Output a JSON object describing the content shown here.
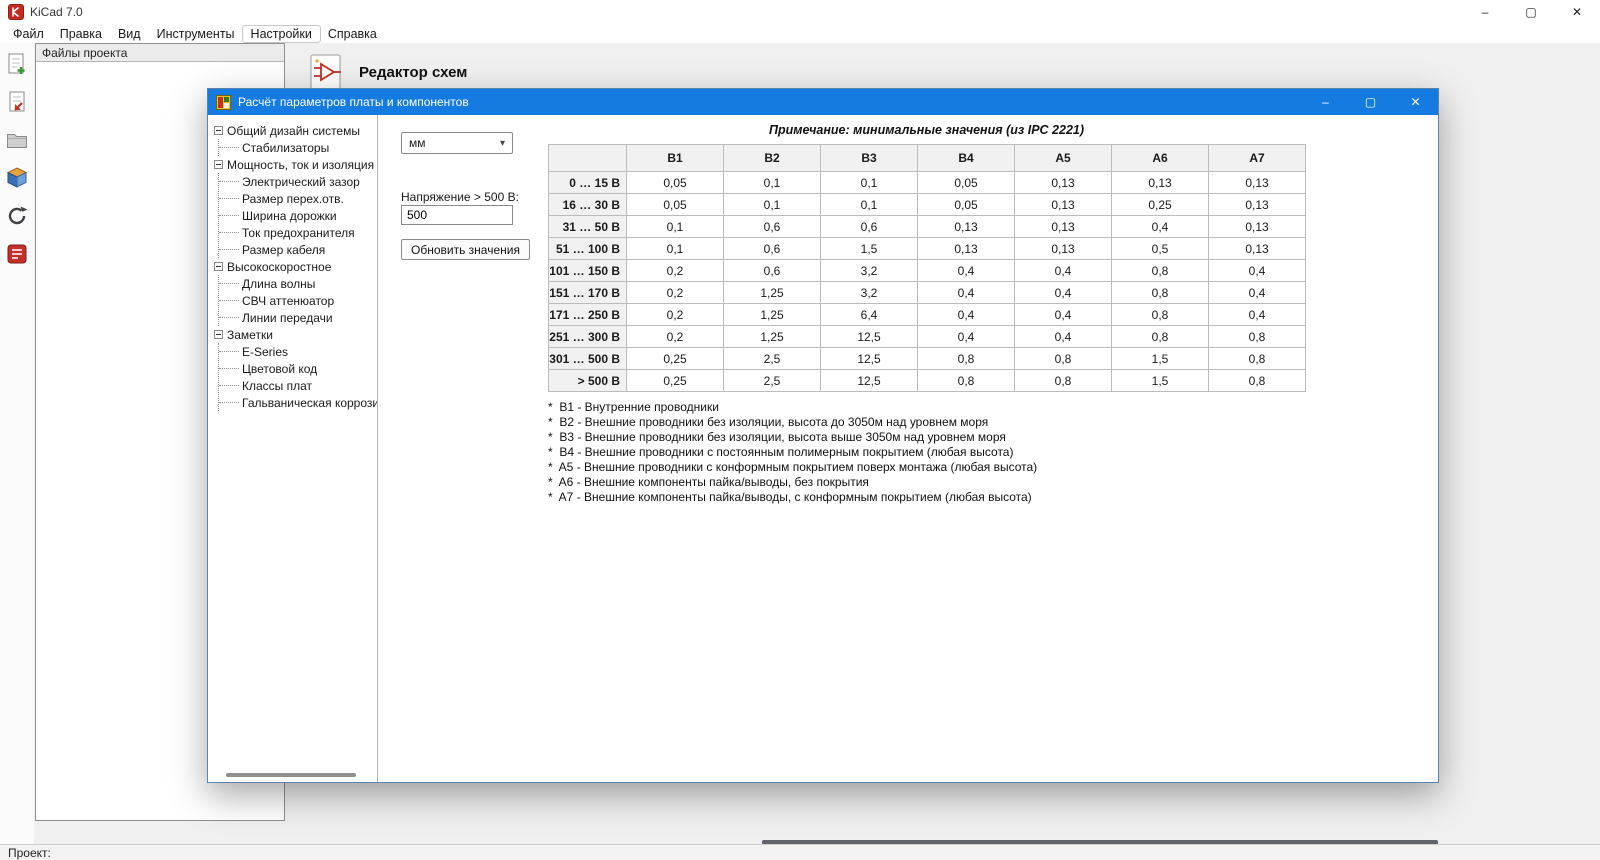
{
  "colors": {
    "dialog_titlebar": "#157be0"
  },
  "icons": {
    "minimize": "–",
    "maximize": "▢",
    "close": "✕",
    "chevron": "▾"
  },
  "app": {
    "title": "KiCad 7.0",
    "menus": [
      "Файл",
      "Правка",
      "Вид",
      "Инструменты",
      "Настройки",
      "Справка"
    ],
    "project_panel": {
      "title": "Файлы проекта"
    },
    "home": {
      "schematic_editor_label": "Редактор схем"
    },
    "statusbar": {
      "project_label": "Проект:"
    }
  },
  "dialog": {
    "title": "Расчёт параметров платы и компонентов",
    "tree": [
      {
        "label": "Общий дизайн системы",
        "level": 0
      },
      {
        "label": "Стабилизаторы",
        "level": 1
      },
      {
        "label": "Мощность, ток и изоляция",
        "level": 0
      },
      {
        "label": "Электрический зазор",
        "level": 1
      },
      {
        "label": "Размер перех.отв.",
        "level": 1
      },
      {
        "label": "Ширина дорожки",
        "level": 1
      },
      {
        "label": "Ток предохранителя",
        "level": 1
      },
      {
        "label": "Размер кабеля",
        "level": 1
      },
      {
        "label": "Высокоскоростное",
        "level": 0
      },
      {
        "label": "Длина волны",
        "level": 1
      },
      {
        "label": "СВЧ аттенюатор",
        "level": 1
      },
      {
        "label": "Линии передачи",
        "level": 1
      },
      {
        "label": "Заметки",
        "level": 0
      },
      {
        "label": "E-Series",
        "level": 1
      },
      {
        "label": "Цветовой код",
        "level": 1
      },
      {
        "label": "Классы плат",
        "level": 1
      },
      {
        "label": "Гальваническая коррози",
        "level": 1
      }
    ],
    "controls": {
      "units": "мм",
      "voltage_label": "Напряжение > 500 В:",
      "voltage_value": "500",
      "update_button": "Обновить значения"
    },
    "table": {
      "note": "Примечание: минимальные значения (из IPC 2221)",
      "headers": [
        "",
        "B1",
        "B2",
        "B3",
        "B4",
        "A5",
        "A6",
        "A7"
      ],
      "rows": [
        {
          "range": "0 … 15 В",
          "values": [
            "0,05",
            "0,1",
            "0,1",
            "0,05",
            "0,13",
            "0,13",
            "0,13"
          ]
        },
        {
          "range": "16 … 30 В",
          "values": [
            "0,05",
            "0,1",
            "0,1",
            "0,05",
            "0,13",
            "0,25",
            "0,13"
          ]
        },
        {
          "range": "31 … 50 В",
          "values": [
            "0,1",
            "0,6",
            "0,6",
            "0,13",
            "0,13",
            "0,4",
            "0,13"
          ]
        },
        {
          "range": "51 … 100 В",
          "values": [
            "0,1",
            "0,6",
            "1,5",
            "0,13",
            "0,13",
            "0,5",
            "0,13"
          ]
        },
        {
          "range": "101 … 150 В",
          "values": [
            "0,2",
            "0,6",
            "3,2",
            "0,4",
            "0,4",
            "0,8",
            "0,4"
          ]
        },
        {
          "range": "151 … 170 В",
          "values": [
            "0,2",
            "1,25",
            "3,2",
            "0,4",
            "0,4",
            "0,8",
            "0,4"
          ]
        },
        {
          "range": "171 … 250 В",
          "values": [
            "0,2",
            "1,25",
            "6,4",
            "0,4",
            "0,4",
            "0,8",
            "0,4"
          ]
        },
        {
          "range": "251 … 300 В",
          "values": [
            "0,2",
            "1,25",
            "12,5",
            "0,4",
            "0,4",
            "0,8",
            "0,8"
          ]
        },
        {
          "range": "301 … 500 В",
          "values": [
            "0,25",
            "2,5",
            "12,5",
            "0,8",
            "0,8",
            "1,5",
            "0,8"
          ]
        },
        {
          "range": "> 500 В",
          "values": [
            "0,25",
            "2,5",
            "12,5",
            "0,8",
            "0,8",
            "1,5",
            "0,8"
          ]
        }
      ],
      "footnotes": [
        "*  B1 - Внутренние проводники",
        "*  B2 - Внешние проводники без изоляции, высота до 3050м над уровнем моря",
        "*  B3 - Внешние проводники без изоляции, высота выше 3050м над уровнем моря",
        "*  B4 - Внешние проводники с постоянным полимерным покрытием (любая высота)",
        "*  A5 - Внешние проводники с конформным покрытием поверх монтажа (любая высота)",
        "*  A6 - Внешние компоненты пайка/выводы, без покрытия",
        "*  A7 - Внешние компоненты пайка/выводы, с конформным покрытием (любая высота)"
      ]
    }
  }
}
